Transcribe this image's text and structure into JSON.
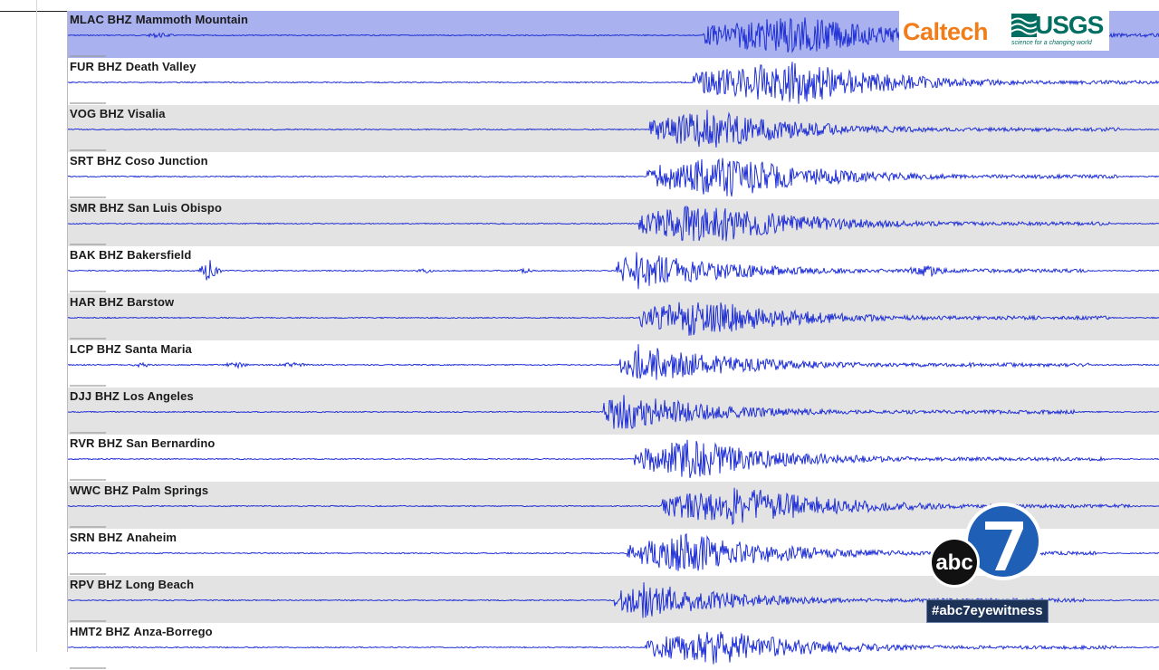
{
  "stations": [
    {
      "code": "MLAC BHZ",
      "name": "Mammoth Mountain",
      "bg": "hilite",
      "onset": 775,
      "peak": 880,
      "amp": 22,
      "pre": [
        [
          10,
          60,
          4
        ],
        [
          160,
          190,
          3
        ]
      ]
    },
    {
      "code": "FUR BHZ",
      "name": "Death Valley",
      "bg": "white",
      "onset": 765,
      "peak": 880,
      "amp": 24,
      "pre": []
    },
    {
      "code": "VOG BHZ",
      "name": "Visalia",
      "bg": "shade",
      "onset": 717,
      "peak": 780,
      "amp": 22,
      "pre": []
    },
    {
      "code": "SRT BHZ",
      "name": "Coso Junction",
      "bg": "white",
      "onset": 714,
      "peak": 800,
      "amp": 24,
      "pre": []
    },
    {
      "code": "SMR BHZ",
      "name": "San Luis Obispo",
      "bg": "shade",
      "onset": 705,
      "peak": 780,
      "amp": 24,
      "pre": []
    },
    {
      "code": "BAK BHZ",
      "name": "Bakersfield",
      "bg": "white",
      "onset": 680,
      "peak": 700,
      "amp": 22,
      "pre": [
        [
          225,
          235,
          14
        ],
        [
          460,
          475,
          3
        ],
        [
          575,
          585,
          3
        ],
        [
          995,
          1050,
          7
        ]
      ]
    },
    {
      "code": "HAR BHZ",
      "name": "Barstow",
      "bg": "shade",
      "onset": 705,
      "peak": 770,
      "amp": 22,
      "pre": []
    },
    {
      "code": "LCP BHZ",
      "name": "Santa Maria",
      "bg": "white",
      "onset": 684,
      "peak": 700,
      "amp": 24,
      "pre": [
        [
          150,
          160,
          4
        ],
        [
          250,
          270,
          4
        ],
        [
          305,
          340,
          3
        ],
        [
          1065,
          1080,
          3
        ]
      ]
    },
    {
      "code": "DJJ BHZ",
      "name": "Los Angeles",
      "bg": "shade",
      "onset": 666,
      "peak": 680,
      "amp": 22,
      "pre": []
    },
    {
      "code": "RVR BHZ",
      "name": "San Bernardino",
      "bg": "white",
      "onset": 700,
      "peak": 760,
      "amp": 22,
      "pre": []
    },
    {
      "code": "WWC BHZ",
      "name": "Palm Springs",
      "bg": "shade",
      "onset": 730,
      "peak": 820,
      "amp": 22,
      "pre": []
    },
    {
      "code": "SRN BHZ",
      "name": "Anaheim",
      "bg": "white",
      "onset": 692,
      "peak": 760,
      "amp": 22,
      "pre": []
    },
    {
      "code": "RPV BHZ",
      "name": "Long Beach",
      "bg": "shade",
      "onset": 678,
      "peak": 710,
      "amp": 20,
      "pre": []
    },
    {
      "code": "HMT2 BHZ",
      "name": "Anza-Borrego",
      "bg": "white",
      "onset": 712,
      "peak": 790,
      "amp": 20,
      "pre": []
    }
  ],
  "logos": {
    "caltech": "Caltech",
    "usgs": "USGS",
    "usgs_tagline": "science for a changing world",
    "abc_text": "abc",
    "abc_number": "7",
    "hashtag": "#abc7eyewitness"
  },
  "colors": {
    "trace": "#1f2fd6",
    "shade": "#e3e3e3",
    "hilite": "#a9b2ee",
    "caltech_orange": "#f07d1a",
    "usgs_green": "#006e60"
  }
}
